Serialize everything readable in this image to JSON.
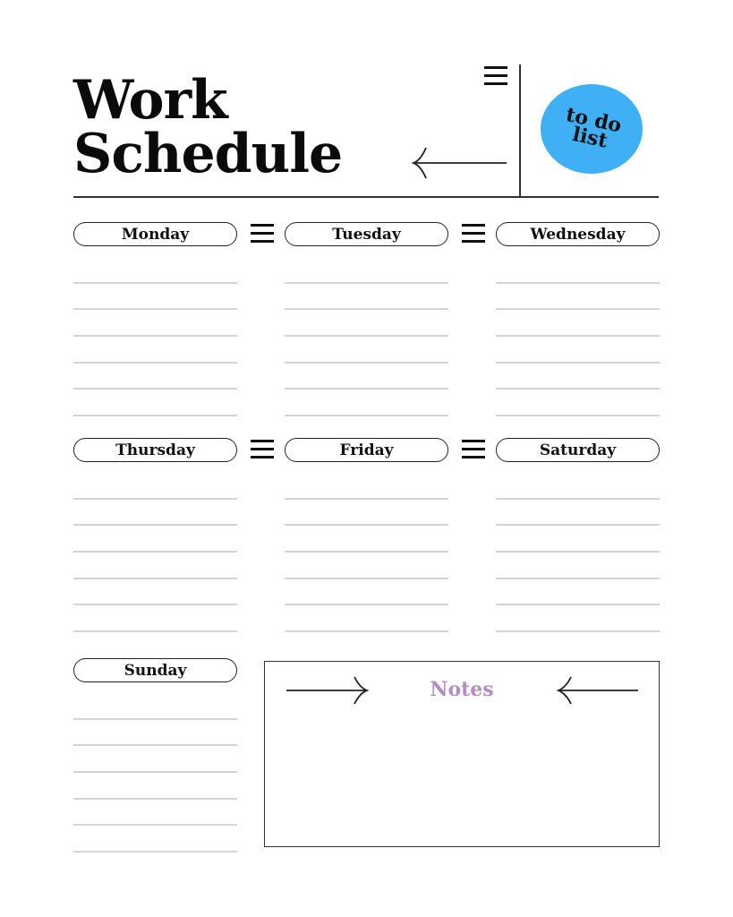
{
  "header": {
    "title_line1": "Work",
    "title_line2": "Schedule",
    "todo_badge_line1": "to do",
    "todo_badge_line2": "list",
    "todo_badge_color": "#3fb0f5"
  },
  "days": [
    {
      "label": "Monday",
      "lines": 6
    },
    {
      "label": "Tuesday",
      "lines": 6
    },
    {
      "label": "Wednesday",
      "lines": 6
    },
    {
      "label": "Thursday",
      "lines": 6
    },
    {
      "label": "Friday",
      "lines": 6
    },
    {
      "label": "Saturday",
      "lines": 6
    },
    {
      "label": "Sunday",
      "lines": 6
    }
  ],
  "notes": {
    "title": "Notes",
    "title_color": "#b48cc4"
  },
  "icons": {
    "menu": "menu-icon",
    "arrow_left": "arrow-left-icon",
    "arrow_right": "arrow-right-icon"
  }
}
